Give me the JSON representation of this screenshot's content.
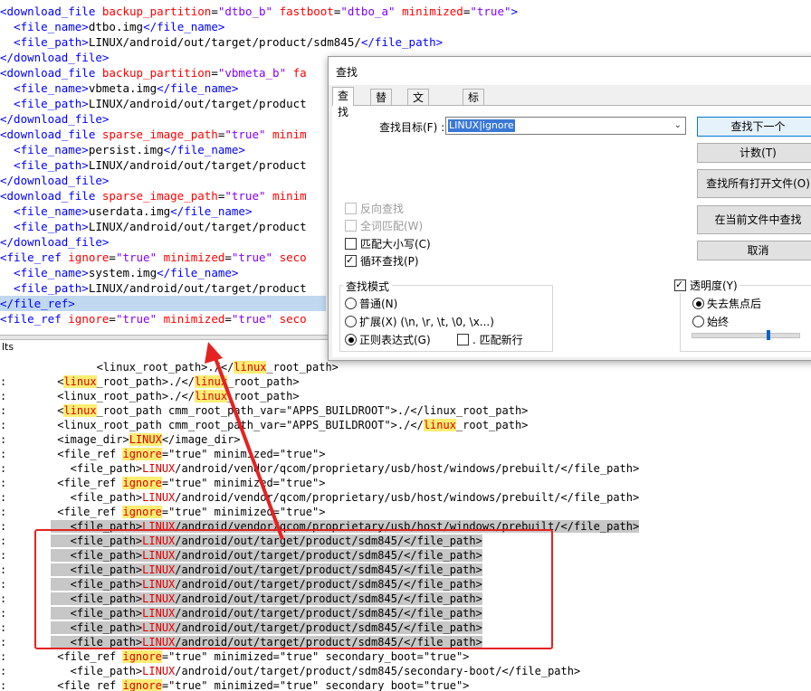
{
  "editor": {
    "lines": [
      {
        "segments": [
          {
            "t": "<download_file ",
            "c": "tag"
          },
          {
            "t": "backup_partition",
            "c": "attr"
          },
          {
            "t": "=",
            "c": ""
          },
          {
            "t": "\"dtbo_b\"",
            "c": "val"
          },
          {
            "t": " ",
            "c": ""
          },
          {
            "t": "fastboot",
            "c": "attr"
          },
          {
            "t": "=",
            "c": ""
          },
          {
            "t": "\"dtbo_a\"",
            "c": "val"
          },
          {
            "t": " ",
            "c": ""
          },
          {
            "t": "minimized",
            "c": "attr"
          },
          {
            "t": "=",
            "c": ""
          },
          {
            "t": "\"true\"",
            "c": "val"
          },
          {
            "t": ">",
            "c": "tag"
          }
        ]
      },
      {
        "segments": [
          {
            "t": "  <file_name>",
            "c": "tag"
          },
          {
            "t": "dtbo.img",
            "c": ""
          },
          {
            "t": "</file_name>",
            "c": "tag"
          }
        ]
      },
      {
        "segments": [
          {
            "t": "  <file_path>",
            "c": "tag"
          },
          {
            "t": "LINUX/android/out/target/product/sdm845/",
            "c": ""
          },
          {
            "t": "</file_path>",
            "c": "tag"
          }
        ]
      },
      {
        "segments": [
          {
            "t": "</download_file>",
            "c": "tag"
          }
        ]
      },
      {
        "segments": [
          {
            "t": "<download_file ",
            "c": "tag"
          },
          {
            "t": "backup_partition",
            "c": "attr"
          },
          {
            "t": "=",
            "c": ""
          },
          {
            "t": "\"vbmeta_b\"",
            "c": "val"
          },
          {
            "t": " ",
            "c": ""
          },
          {
            "t": "fa",
            "c": "attr"
          }
        ]
      },
      {
        "segments": [
          {
            "t": "  <file_name>",
            "c": "tag"
          },
          {
            "t": "vbmeta.img",
            "c": ""
          },
          {
            "t": "</file_name>",
            "c": "tag"
          }
        ]
      },
      {
        "segments": [
          {
            "t": "  <file_path>",
            "c": "tag"
          },
          {
            "t": "LINUX/android/out/target/product",
            "c": ""
          }
        ]
      },
      {
        "segments": [
          {
            "t": "</download_file>",
            "c": "tag"
          }
        ]
      },
      {
        "segments": [
          {
            "t": "<download_file ",
            "c": "tag"
          },
          {
            "t": "sparse_image_path",
            "c": "attr"
          },
          {
            "t": "=",
            "c": ""
          },
          {
            "t": "\"true\"",
            "c": "val"
          },
          {
            "t": " ",
            "c": ""
          },
          {
            "t": "minim",
            "c": "attr"
          }
        ]
      },
      {
        "segments": [
          {
            "t": "  <file_name>",
            "c": "tag"
          },
          {
            "t": "persist.img",
            "c": ""
          },
          {
            "t": "</file_name>",
            "c": "tag"
          }
        ]
      },
      {
        "segments": [
          {
            "t": "  <file_path>",
            "c": "tag"
          },
          {
            "t": "LINUX/android/out/target/product",
            "c": ""
          }
        ]
      },
      {
        "segments": [
          {
            "t": "</download_file>",
            "c": "tag"
          }
        ]
      },
      {
        "segments": [
          {
            "t": "<download_file ",
            "c": "tag"
          },
          {
            "t": "sparse_image_path",
            "c": "attr"
          },
          {
            "t": "=",
            "c": ""
          },
          {
            "t": "\"true\"",
            "c": "val"
          },
          {
            "t": " ",
            "c": ""
          },
          {
            "t": "minim",
            "c": "attr"
          }
        ]
      },
      {
        "segments": [
          {
            "t": "  <file_name>",
            "c": "tag"
          },
          {
            "t": "userdata.img",
            "c": ""
          },
          {
            "t": "</file_name>",
            "c": "tag"
          }
        ]
      },
      {
        "segments": [
          {
            "t": "  <file_path>",
            "c": "tag"
          },
          {
            "t": "LINUX/android/out/target/product",
            "c": ""
          }
        ]
      },
      {
        "segments": [
          {
            "t": "</download_file>",
            "c": "tag"
          }
        ]
      },
      {
        "segments": [
          {
            "t": "<file_ref ",
            "c": "tag"
          },
          {
            "t": "ignore",
            "c": "attr"
          },
          {
            "t": "=",
            "c": ""
          },
          {
            "t": "\"true\"",
            "c": "val"
          },
          {
            "t": " ",
            "c": ""
          },
          {
            "t": "minimized",
            "c": "attr"
          },
          {
            "t": "=",
            "c": ""
          },
          {
            "t": "\"true\"",
            "c": "val"
          },
          {
            "t": " ",
            "c": ""
          },
          {
            "t": "seco",
            "c": "attr"
          }
        ]
      },
      {
        "segments": [
          {
            "t": "  <file_name>",
            "c": "tag"
          },
          {
            "t": "system.img",
            "c": ""
          },
          {
            "t": "</file_name>",
            "c": "tag"
          }
        ]
      },
      {
        "segments": [
          {
            "t": "  <file_path>",
            "c": "tag"
          },
          {
            "t": "LINUX/android/out/target/product",
            "c": ""
          }
        ]
      },
      {
        "segments": [
          {
            "t": "</file_ref>",
            "c": "tag"
          }
        ],
        "selected": true
      },
      {
        "segments": [
          {
            "t": "<file_ref ",
            "c": "tag"
          },
          {
            "t": "ignore",
            "c": "attr"
          },
          {
            "t": "=",
            "c": ""
          },
          {
            "t": "\"true\"",
            "c": "val"
          },
          {
            "t": " ",
            "c": ""
          },
          {
            "t": "minimized",
            "c": "attr"
          },
          {
            "t": "=",
            "c": ""
          },
          {
            "t": "\"true\"",
            "c": "val"
          },
          {
            "t": " ",
            "c": ""
          },
          {
            "t": "seco",
            "c": "attr"
          }
        ]
      }
    ]
  },
  "results": {
    "header": "lts",
    "lines": [
      {
        "colon": "",
        "gray": false,
        "segments": [
          {
            "t": "       <linux_root_path>./</",
            "h": ""
          },
          {
            "t": "linux",
            "h": "y"
          },
          {
            "t": "_root_path>",
            "h": ""
          }
        ]
      },
      {
        "colon": ":",
        "gray": false,
        "segments": [
          {
            "t": " <",
            "h": ""
          },
          {
            "t": "linux",
            "h": "y"
          },
          {
            "t": "_root_path>./</",
            "h": ""
          },
          {
            "t": "linux",
            "h": "y"
          },
          {
            "t": "_root_path>",
            "h": ""
          }
        ]
      },
      {
        "colon": ":",
        "gray": false,
        "segments": [
          {
            "t": " <linux_root_path>./</",
            "h": ""
          },
          {
            "t": "linux",
            "h": "y"
          },
          {
            "t": "_root_path>",
            "h": ""
          }
        ]
      },
      {
        "colon": ":",
        "gray": false,
        "segments": [
          {
            "t": " <",
            "h": ""
          },
          {
            "t": "linux",
            "h": "y"
          },
          {
            "t": "_root_path cmm_root_path_var=\"APPS_BUILDROOT\">./</linux_root_path>",
            "h": ""
          }
        ]
      },
      {
        "colon": ":",
        "gray": false,
        "segments": [
          {
            "t": " <linux_root_path cmm_root_path_var=\"APPS_BUILDROOT\">./</",
            "h": ""
          },
          {
            "t": "linux",
            "h": "y"
          },
          {
            "t": "_root_path>",
            "h": ""
          }
        ]
      },
      {
        "colon": ":",
        "gray": false,
        "segments": [
          {
            "t": " <image_dir>",
            "h": ""
          },
          {
            "t": "LINUX",
            "h": "y"
          },
          {
            "t": "</image_dir>",
            "h": ""
          }
        ]
      },
      {
        "colon": ":",
        "gray": false,
        "segments": [
          {
            "t": " <file_ref ",
            "h": ""
          },
          {
            "t": "ignore",
            "h": "y"
          },
          {
            "t": "=\"true\" minimized=\"true\">",
            "h": ""
          }
        ]
      },
      {
        "colon": ":",
        "gray": false,
        "segments": [
          {
            "t": "   <file_path>",
            "h": ""
          },
          {
            "t": "LINUX",
            "h": "r"
          },
          {
            "t": "/android/vendor/qcom/proprietary/usb/host/windows/prebuilt/</file_path>",
            "h": ""
          }
        ]
      },
      {
        "colon": ":",
        "gray": false,
        "segments": [
          {
            "t": " <file_ref ",
            "h": ""
          },
          {
            "t": "ignore",
            "h": "y"
          },
          {
            "t": "=\"true\" minimized=\"true\">",
            "h": ""
          }
        ]
      },
      {
        "colon": ":",
        "gray": false,
        "segments": [
          {
            "t": "   <file_path>",
            "h": ""
          },
          {
            "t": "LINUX",
            "h": "r"
          },
          {
            "t": "/android/vendor/qcom/proprietary/usb/host/windows/prebuilt/</file_path>",
            "h": ""
          }
        ]
      },
      {
        "colon": ":",
        "gray": false,
        "segments": [
          {
            "t": " <file_ref ",
            "h": ""
          },
          {
            "t": "ignore",
            "h": "y"
          },
          {
            "t": "=\"true\" minimized=\"true\">",
            "h": ""
          }
        ]
      },
      {
        "colon": ":",
        "gray": true,
        "segments": [
          {
            "t": "   <file_path>",
            "h": ""
          },
          {
            "t": "LINUX",
            "h": "r"
          },
          {
            "t": "/android/vendor/qcom/proprietary/usb/host/windows/prebuilt/</file_path>",
            "h": ""
          }
        ]
      },
      {
        "colon": ":",
        "gray": true,
        "segments": [
          {
            "t": "   <file_path>",
            "h": ""
          },
          {
            "t": "LINUX",
            "h": "r"
          },
          {
            "t": "/android/out/target/product/sdm845/</file_path>",
            "h": ""
          }
        ]
      },
      {
        "colon": ":",
        "gray": true,
        "segments": [
          {
            "t": "   <file_path>",
            "h": ""
          },
          {
            "t": "LINUX",
            "h": "r"
          },
          {
            "t": "/android/out/target/product/sdm845/</file_path>",
            "h": ""
          }
        ]
      },
      {
        "colon": ":",
        "gray": true,
        "segments": [
          {
            "t": "   <file_path>",
            "h": ""
          },
          {
            "t": "LINUX",
            "h": "r"
          },
          {
            "t": "/android/out/target/product/sdm845/</file_path>",
            "h": ""
          }
        ]
      },
      {
        "colon": ":",
        "gray": true,
        "segments": [
          {
            "t": "   <file_path>",
            "h": ""
          },
          {
            "t": "LINUX",
            "h": "r"
          },
          {
            "t": "/android/out/target/product/sdm845/</file_path>",
            "h": ""
          }
        ]
      },
      {
        "colon": ":",
        "gray": true,
        "segments": [
          {
            "t": "   <file_path>",
            "h": ""
          },
          {
            "t": "LINUX",
            "h": "r"
          },
          {
            "t": "/android/out/target/product/sdm845/</file_path>",
            "h": ""
          }
        ]
      },
      {
        "colon": ":",
        "gray": true,
        "segments": [
          {
            "t": "   <file_path>",
            "h": ""
          },
          {
            "t": "LINUX",
            "h": "r"
          },
          {
            "t": "/android/out/target/product/sdm845/</file_path>",
            "h": ""
          }
        ]
      },
      {
        "colon": ":",
        "gray": true,
        "segments": [
          {
            "t": "   <file_path>",
            "h": ""
          },
          {
            "t": "LINUX",
            "h": "r"
          },
          {
            "t": "/android/out/target/product/sdm845/</file_path>",
            "h": ""
          }
        ]
      },
      {
        "colon": ":",
        "gray": true,
        "segments": [
          {
            "t": "   <file_path>",
            "h": ""
          },
          {
            "t": "LINUX",
            "h": "r"
          },
          {
            "t": "/android/out/target/product/sdm845/</file_path>",
            "h": ""
          }
        ]
      },
      {
        "colon": ":",
        "gray": false,
        "segments": [
          {
            "t": " <file_ref ",
            "h": ""
          },
          {
            "t": "ignore",
            "h": "y"
          },
          {
            "t": "=\"true\" minimized=\"true\" secondary_boot=\"true\">",
            "h": ""
          }
        ]
      },
      {
        "colon": ":",
        "gray": false,
        "segments": [
          {
            "t": "   <file_path>",
            "h": ""
          },
          {
            "t": "LINUX",
            "h": "r"
          },
          {
            "t": "/android/out/target/product/sdm845/secondary-boot/</file_path>",
            "h": ""
          }
        ]
      },
      {
        "colon": ":",
        "gray": false,
        "segments": [
          {
            "t": " <file_ref ",
            "h": ""
          },
          {
            "t": "ignore",
            "h": "y"
          },
          {
            "t": "=\"true\" minimized=\"true\" secondary_boot=\"true\">",
            "h": ""
          }
        ]
      }
    ]
  },
  "dialog": {
    "title": "查找",
    "tabs": [
      "查找",
      "替换",
      "文件查找",
      "标记"
    ],
    "find_label": "查找目标(F) :",
    "find_value": "LINUX|ignore",
    "buttons": {
      "find_next": "查找下一个",
      "count": "计数(T)",
      "find_all_open": "查找所有打开文件(O)",
      "find_in_current": "在当前文件中查找",
      "cancel": "取消"
    },
    "options": {
      "backward": "反向查找",
      "whole_word": "全词匹配(W)",
      "match_case": "匹配大小写(C)",
      "wrap_around": "循环查找(P)"
    },
    "search_mode": {
      "title": "查找模式",
      "normal": "普通(N)",
      "extended": "扩展(X) (\\n, \\r, \\t, \\0, \\x...)",
      "regex": "正则表达式(G)",
      "dot_newline": ". 匹配新行"
    },
    "transparency": {
      "title": "透明度(Y)",
      "on_lose_focus": "失去焦点后",
      "always": "始终",
      "level": 0.72
    }
  },
  "colors": {
    "callout": "#e52222",
    "accent": "#0078d7"
  }
}
